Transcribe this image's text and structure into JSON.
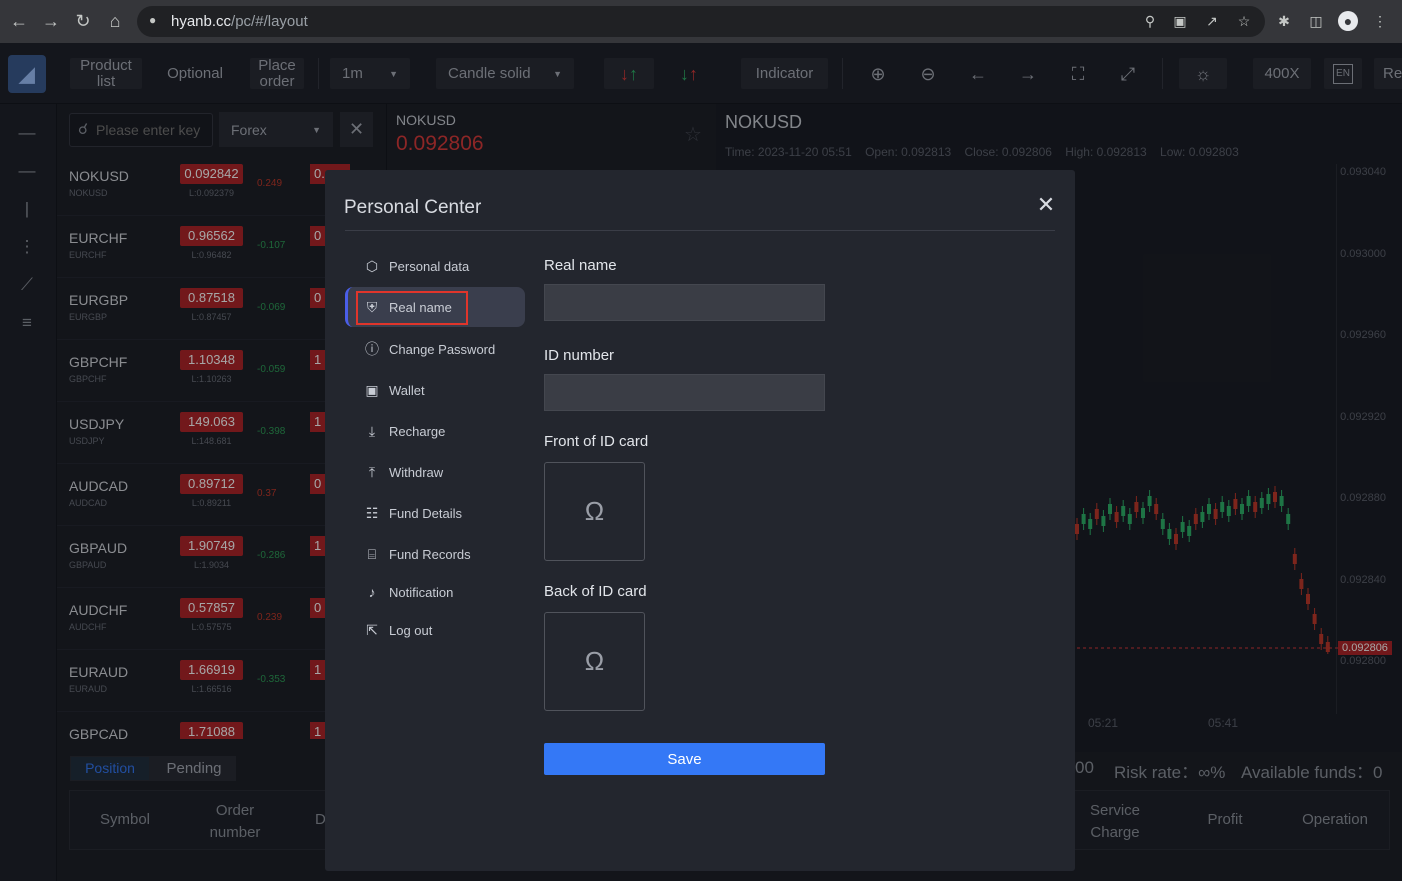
{
  "browser": {
    "url_host": "hyanb.cc",
    "url_path": "/pc/#/layout"
  },
  "toolbar": {
    "product_list": "Product list",
    "optional": "Optional",
    "place_order": "Place order",
    "interval": "1m",
    "chart_style": "Candle solid",
    "indicator": "Indicator",
    "leverage": "400X",
    "lang": "EN",
    "re": "Re"
  },
  "market": {
    "search_placeholder": "Please enter key",
    "category": "Forex",
    "rows": [
      {
        "symbol": "NOKUSD",
        "sub": "NOKUSD",
        "price": "0.092842",
        "low": "L:0.092379",
        "change": "0.249",
        "change_color": "#c0392b",
        "price2": "0."
      },
      {
        "symbol": "EURCHF",
        "sub": "EURCHF",
        "price": "0.96562",
        "low": "L:0.96482",
        "change": "-0.107",
        "change_color": "#2e9e58",
        "price2": "0"
      },
      {
        "symbol": "EURGBP",
        "sub": "EURGBP",
        "price": "0.87518",
        "low": "L:0.87457",
        "change": "-0.069",
        "change_color": "#2e9e58",
        "price2": "0"
      },
      {
        "symbol": "GBPCHF",
        "sub": "GBPCHF",
        "price": "1.10348",
        "low": "L:1.10263",
        "change": "-0.059",
        "change_color": "#2e9e58",
        "price2": "1"
      },
      {
        "symbol": "USDJPY",
        "sub": "USDJPY",
        "price": "149.063",
        "low": "L:148.681",
        "change": "-0.398",
        "change_color": "#2e9e58",
        "price2": "1"
      },
      {
        "symbol": "AUDCAD",
        "sub": "AUDCAD",
        "price": "0.89712",
        "low": "L:0.89211",
        "change": "0.37",
        "change_color": "#c0392b",
        "price2": "0"
      },
      {
        "symbol": "GBPAUD",
        "sub": "GBPAUD",
        "price": "1.90749",
        "low": "L:1.9034",
        "change": "-0.286",
        "change_color": "#2e9e58",
        "price2": "1"
      },
      {
        "symbol": "AUDCHF",
        "sub": "AUDCHF",
        "price": "0.57857",
        "low": "L:0.57575",
        "change": "0.239",
        "change_color": "#c0392b",
        "price2": "0"
      },
      {
        "symbol": "EURAUD",
        "sub": "EURAUD",
        "price": "1.66919",
        "low": "L:1.66516",
        "change": "-0.353",
        "change_color": "#2e9e58",
        "price2": "1"
      },
      {
        "symbol": "GBPCAD",
        "sub": "GBPCAD",
        "price": "1.71088",
        "low": "",
        "change": "",
        "change_color": "#c0392b",
        "price2": "1"
      }
    ]
  },
  "ticker": {
    "symbol": "NOKUSD",
    "price": "0.092806"
  },
  "chart": {
    "title": "NOKUSD",
    "time": "Time: 2023-11-20 05:51",
    "open": "Open: 0.092813",
    "close": "Close: 0.092806",
    "high": "High: 0.092813",
    "low": "Low: 0.092803",
    "y_labels": [
      "0.093040",
      "0.093000",
      "0.092960",
      "0.092920",
      "0.092880",
      "0.092840",
      "0.092800"
    ],
    "current_price": "0.092806",
    "x_labels": [
      "05:21",
      "05:41"
    ]
  },
  "account": {
    "balance_tail": "00",
    "risk_rate": "Risk rate：∞%",
    "available_funds": "Available funds：0"
  },
  "bottom": {
    "tabs": [
      "Position",
      "Pending"
    ],
    "headers": [
      "Symbol",
      "Order number",
      "Di",
      "Service Charge",
      "Profit",
      "Operation"
    ]
  },
  "modal": {
    "title": "Personal Center",
    "menu": [
      {
        "label": "Personal data",
        "icon": "hexagon-icon"
      },
      {
        "label": "Real name",
        "icon": "shield-icon"
      },
      {
        "label": "Change Password",
        "icon": "alert-circle-icon"
      },
      {
        "label": "Wallet",
        "icon": "wallet-icon"
      },
      {
        "label": "Recharge",
        "icon": "download-arrow-icon"
      },
      {
        "label": "Withdraw",
        "icon": "upload-arrow-icon"
      },
      {
        "label": "Fund Details",
        "icon": "list-icon"
      },
      {
        "label": "Fund Records",
        "icon": "document-icon"
      },
      {
        "label": "Notification",
        "icon": "bell-icon"
      },
      {
        "label": "Log out",
        "icon": "logout-icon"
      }
    ],
    "active_index": 1,
    "real_name_label": "Real name",
    "real_name_value": "",
    "id_number_label": "ID number",
    "id_number_value": "",
    "front_label": "Front of ID card",
    "back_label": "Back of ID card",
    "save_label": "Save"
  },
  "colors": {
    "accent": "#3478f6",
    "price_red": "#b0262a",
    "highlight": "#e0352b"
  }
}
